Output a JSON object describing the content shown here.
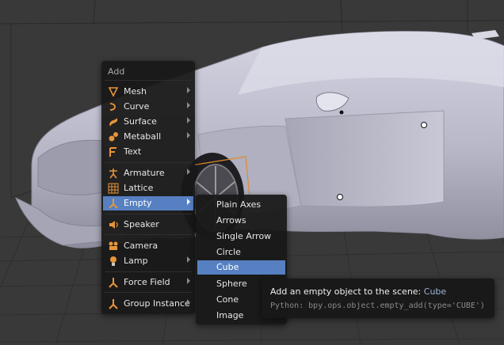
{
  "add_menu": {
    "title": "Add",
    "items": [
      {
        "label": "Mesh",
        "icon": "mesh-icon",
        "submenu": true
      },
      {
        "label": "Curve",
        "icon": "curve-icon",
        "submenu": true
      },
      {
        "label": "Surface",
        "icon": "surface-icon",
        "submenu": true
      },
      {
        "label": "Metaball",
        "icon": "metaball-icon",
        "submenu": true
      },
      {
        "label": "Text",
        "icon": "text-icon",
        "submenu": false
      },
      {
        "label": "Armature",
        "icon": "armature-icon",
        "submenu": true
      },
      {
        "label": "Lattice",
        "icon": "lattice-icon",
        "submenu": false
      },
      {
        "label": "Empty",
        "icon": "empty-icon",
        "submenu": true,
        "highlighted": true
      },
      {
        "label": "Speaker",
        "icon": "speaker-icon",
        "submenu": false
      },
      {
        "label": "Camera",
        "icon": "camera-icon",
        "submenu": false
      },
      {
        "label": "Lamp",
        "icon": "lamp-icon",
        "submenu": true
      },
      {
        "label": "Force Field",
        "icon": "force-field-icon",
        "submenu": true
      },
      {
        "label": "Group Instance",
        "icon": "group-instance-icon",
        "submenu": true
      }
    ]
  },
  "empty_menu": {
    "items": [
      {
        "label": "Plain Axes"
      },
      {
        "label": "Arrows"
      },
      {
        "label": "Single Arrow"
      },
      {
        "label": "Circle"
      },
      {
        "label": "Cube",
        "highlighted": true
      },
      {
        "label": "Sphere"
      },
      {
        "label": "Cone"
      },
      {
        "label": "Image"
      }
    ]
  },
  "tooltip": {
    "description": "Add an empty object to the scene:",
    "value": "Cube",
    "python": "Python: bpy.ops.object.empty_add(type='CUBE')"
  },
  "colors": {
    "highlight": "#5680c2",
    "icon_orange": "#e8953a",
    "menu_bg": "#181818",
    "viewport_bg": "#393939"
  }
}
